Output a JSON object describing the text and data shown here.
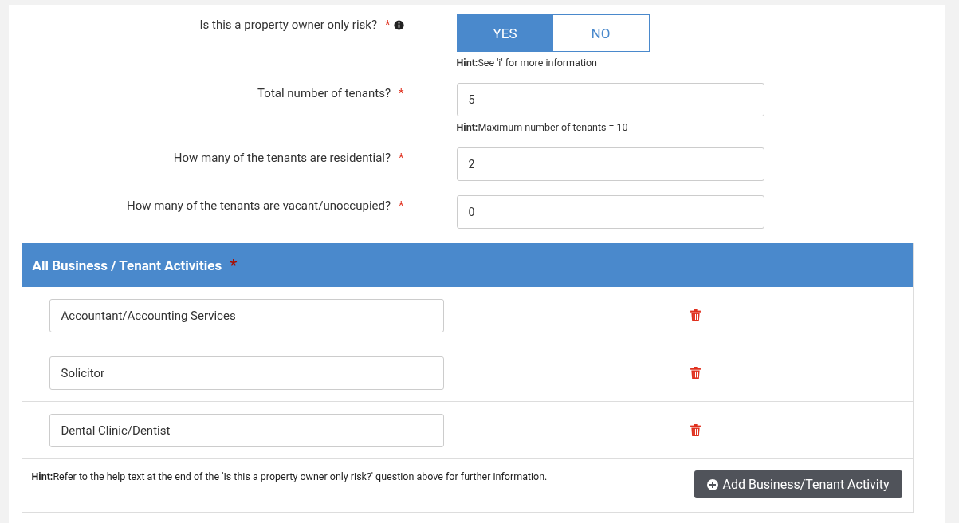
{
  "questions": [
    {
      "kind": "toggle",
      "label": "Is this a property owner only risk?",
      "required_mark": "*",
      "info": true,
      "options": [
        {
          "label": "YES",
          "selected": true
        },
        {
          "label": "NO",
          "selected": false
        }
      ],
      "hint": "**Hint:**See 'i' for more information"
    },
    {
      "kind": "number",
      "label": "Total number of tenants?",
      "required_mark": "*",
      "value": "5",
      "hint": "**Hint:**Maximum number of tenants = 10"
    },
    {
      "kind": "number",
      "label": "How many of the tenants are residential?",
      "required_mark": "*",
      "value": "2"
    },
    {
      "kind": "number",
      "label": "How many of the tenants are vacant/unoccupied?",
      "required_mark": "*",
      "value": "0"
    }
  ],
  "activities": {
    "title": "All Business / Tenant Activities",
    "required_mark": "*",
    "items": [
      {
        "value": "Accountant/Accounting Services"
      },
      {
        "value": "Solicitor"
      },
      {
        "value": "Dental Clinic/Dentist"
      }
    ],
    "hint": "**Hint:**Refer to the help text at the end of the 'Is this a property owner only risk?' question above for further information.",
    "add_button": "Add Business/Tenant Activity"
  }
}
